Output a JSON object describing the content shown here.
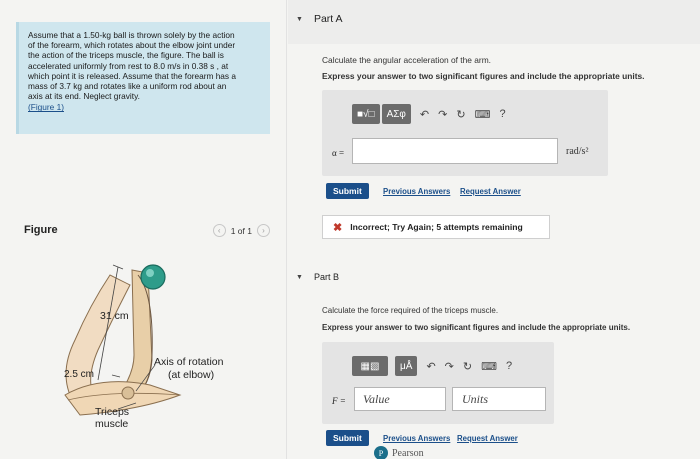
{
  "problem": {
    "lines": [
      "Assume that a 1.50-kg ball is thrown solely by the action",
      "of the forearm, which rotates about the elbow joint under",
      "the action of the triceps muscle, the figure. The ball is",
      "accelerated uniformly from rest to 8.0 m/s in 0.38 s , at",
      "which point it is released. Assume that the forearm has a",
      "mass of 3.7 kg and rotates like a uniform rod about an",
      "axis at its end. Neglect gravity."
    ],
    "figure_link": "(Figure 1)"
  },
  "figure_panel": {
    "title": "Figure",
    "pager_text": "1 of 1",
    "labels": {
      "length_forearm": "31 cm",
      "length_triceps": "2.5 cm",
      "axis_line1": "Axis of rotation",
      "axis_line2": "(at elbow)",
      "triceps_line1": "Triceps",
      "triceps_line2": "muscle"
    }
  },
  "partA": {
    "header": "Part A",
    "question": "Calculate the angular acceleration of the arm.",
    "instruction": "Express your answer to two significant figures and include the appropriate units.",
    "toolbar": {
      "template_btn": "■√□",
      "greek_btn": "ΑΣφ",
      "help": "?"
    },
    "variable": "α =",
    "answer_value": "",
    "units": "rad/s²",
    "submit": "Submit",
    "previous_answers": "Previous Answers",
    "request_answer": "Request Answer",
    "feedback": "Incorrect; Try Again; 5 attempts remaining"
  },
  "partB": {
    "header": "Part B",
    "question": "Calculate the force required of the triceps muscle.",
    "instruction": "Express your answer to two significant figures and include the appropriate units.",
    "toolbar": {
      "units_btn": "μÅ",
      "help": "?"
    },
    "variable": "F =",
    "value_placeholder": "Value",
    "units_placeholder": "Units",
    "submit": "Submit",
    "previous_answers": "Previous Answers",
    "request_answer": "Request Answer"
  },
  "footer": {
    "brand": "Pearson"
  },
  "colors": {
    "accent": "#1b4f8a",
    "problem_bg": "#cfe6ee",
    "error": "#c0392b"
  }
}
